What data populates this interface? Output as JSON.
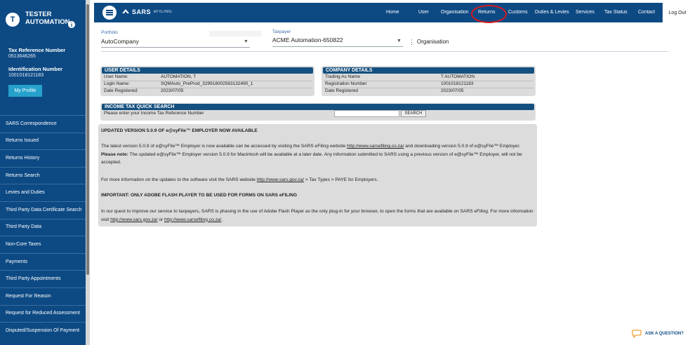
{
  "sidebar": {
    "avatar_letter": "T",
    "user_name": "TESTER AUTOMATION",
    "info_glyph": "i",
    "tax_ref_label": "Tax Reference Number",
    "tax_ref_value": "0513646265",
    "id_label": "Identification Number",
    "id_value": "1001018121183",
    "profile_button": "My Profile",
    "menu": [
      "SARS Correspondence",
      "Returns Issued",
      "Returns History",
      "Returns Search",
      "Levies and Duties",
      "Third Party Data Certificate Search",
      "Third Party Data",
      "Non-Core Taxes",
      "Payments",
      "Third Party Appointments",
      "Request For Reason",
      "Request for Reduced Assessment",
      "Disputed/Suspension Of Payment"
    ]
  },
  "topnav": {
    "logo": "SARS",
    "logo_sub": "eFILING",
    "links": [
      "Home",
      "User",
      "Organisation",
      "Returns",
      "Customs",
      "Duties & Levies",
      "Services",
      "Tax Status",
      "Contact"
    ],
    "logout": "Log Out",
    "highlight_color": "#d9191f"
  },
  "selectors": {
    "portfolio_label": "Portfolio",
    "portfolio_value": "AutoCompany",
    "taxpayer_label": "Taxpayer",
    "taxpayer_value": "ACME Automation-650822",
    "context_label": "Organisation"
  },
  "user_details": {
    "header": "USER DETAILS",
    "rows": [
      {
        "label": "User Name:",
        "value": "AUTOMATION, T"
      },
      {
        "label": "Login Name:",
        "value": "SQMAuto_PreProd_329918002563132490_1"
      },
      {
        "label": "Date Registered:",
        "value": "2023/07/05"
      }
    ]
  },
  "company_details": {
    "header": "COMPANY DETAILS",
    "rows": [
      {
        "label": "Trading As Name",
        "value": "T AUTOMATION"
      },
      {
        "label": "Registration Number",
        "value": "1001018121183"
      },
      {
        "label": "Date Registered",
        "value": "2023/07/05"
      }
    ]
  },
  "quick_search": {
    "header": "INCOME TAX QUICK SEARCH",
    "prompt": "Please enter your Income Tax Reference Number",
    "input_value": "",
    "button": "SEARCH"
  },
  "messages": {
    "heading1": "UPDATED VERSION 5.0.9 OF e@syFile™ EMPLOYER NOW AVAILABLE",
    "para1_a": "The latest version 5.0.9 of e@syFile™ Employer is now available can be accessed by visiting the SARS eFiling website ",
    "para1_link": "http://www.sarsefiling.co.za/",
    "para1_b": " and downloading version 5.0.9 of e@syFile™ Employer. ",
    "para1_note": "Please note:",
    "para1_c": " The updated e@syFile™ Employer version 5.0.9 for Macintosh will be available at a later date. Any information submitted to SARS using a previous version of e@syFile™ Employer, will not be accepted.",
    "para2_a": "For more information on the updates to the software visit the SARS website ",
    "para2_link": "http://www.sars.gov.za/",
    "para2_b": " > Tax Types > PAYE for Employers.",
    "heading2": "IMPORTANT: ONLY ADOBE FLASH PLAYER TO BE USED FOR FORMS ON SARS eFILING",
    "para3_a": "In our quest to improve our service to taxpayers, SARS is phasing in the use of Adobe Flash Player as the only plug-in for your browser, to open the forms that are available on SARS eFiling. For more information visit ",
    "para3_link1": "http://www.sars.gov.za/",
    "para3_or": " or ",
    "para3_link2": "http://www.sarsefiling.co.za/",
    "para3_end": "."
  },
  "help": {
    "ask": "ASK A QUESTION?"
  }
}
